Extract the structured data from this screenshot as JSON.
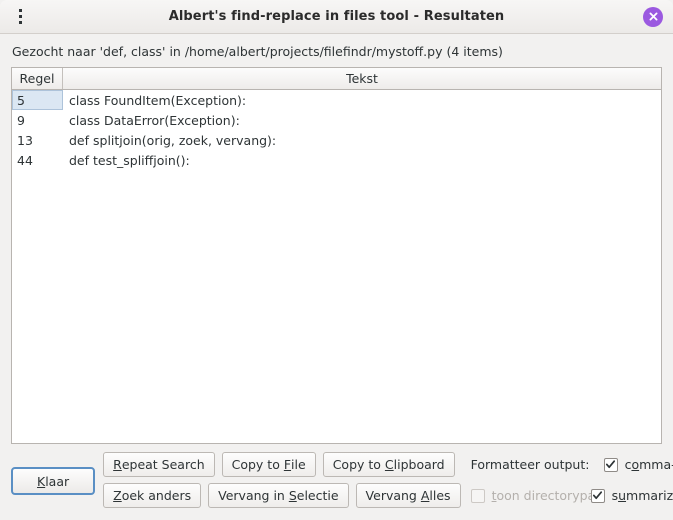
{
  "window": {
    "title": "Albert's find-replace in files tool - Resultaten",
    "menu_icon": "kebab-menu-icon",
    "close_icon": "close-icon",
    "accent_color": "#9b59e0"
  },
  "summary": {
    "text": "Gezocht naar 'def, class' in /home/albert/projects/filefindr/mystoff.py (4 items)"
  },
  "table": {
    "columns": [
      {
        "key": "line",
        "label": "Regel"
      },
      {
        "key": "text",
        "label": "Tekst"
      }
    ],
    "rows": [
      {
        "line": "5",
        "text": "class FoundItem(Exception):",
        "selected": true
      },
      {
        "line": "9",
        "text": "class DataError(Exception):",
        "selected": false
      },
      {
        "line": "13",
        "text": "def splitjoin(orig, zoek, vervang):",
        "selected": false
      },
      {
        "line": "44",
        "text": "def test_spliffjoin():",
        "selected": false
      }
    ]
  },
  "buttons": {
    "done": {
      "label": "Klaar",
      "mnemonic": "K",
      "default": true
    },
    "row1": [
      {
        "label": "Repeat Search",
        "mnemonic": "R"
      },
      {
        "label": "Copy to File",
        "mnemonic": "F"
      },
      {
        "label": "Copy to Clipboard",
        "mnemonic": "C"
      }
    ],
    "row2": [
      {
        "label": "Zoek anders",
        "mnemonic": "Z"
      },
      {
        "label": "Vervang in Selectie",
        "mnemonic": "S"
      },
      {
        "label": "Vervang Alles",
        "mnemonic": "A"
      }
    ]
  },
  "options": {
    "format_label": "Formatteer output:",
    "show_dirpath": {
      "label": "toon directorypad",
      "mnemonic": "t",
      "checked": false,
      "enabled": false
    },
    "comma_delimited": {
      "label": "comma-delimited",
      "mnemonic": "o",
      "checked": true,
      "enabled": true
    },
    "summarized": {
      "label": "summarized",
      "mnemonic": "u",
      "checked": true,
      "enabled": true
    }
  }
}
